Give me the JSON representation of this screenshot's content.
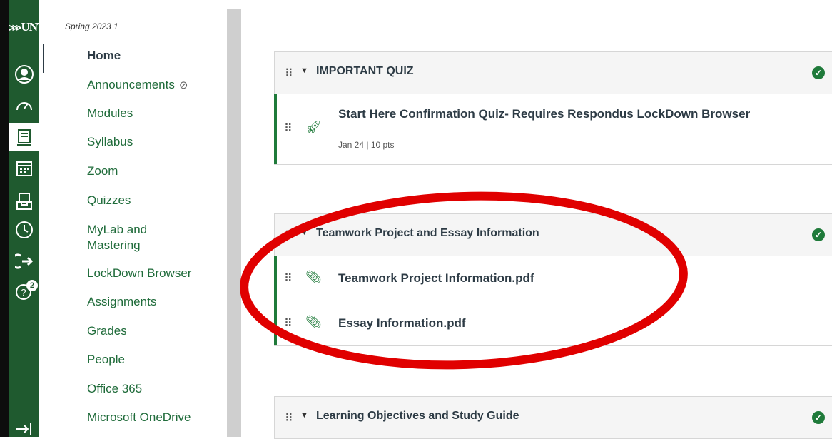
{
  "global_nav": {
    "logo": "UNT",
    "help_badge": "2"
  },
  "course_nav": {
    "term": "Spring 2023 1",
    "items": [
      {
        "label": "Home"
      },
      {
        "label": "Announcements"
      },
      {
        "label": "Modules"
      },
      {
        "label": "Syllabus"
      },
      {
        "label": "Zoom"
      },
      {
        "label": "Quizzes"
      },
      {
        "label": "MyLab and Mastering"
      },
      {
        "label": "LockDown Browser"
      },
      {
        "label": "Assignments"
      },
      {
        "label": "Grades"
      },
      {
        "label": "People"
      },
      {
        "label": "Office 365"
      },
      {
        "label": "Microsoft OneDrive"
      }
    ]
  },
  "modules": [
    {
      "title": "IMPORTANT QUIZ",
      "items": [
        {
          "title": "Start Here Confirmation Quiz- Requires Respondus LockDown Browser",
          "meta": "Jan 24  |  10 pts"
        }
      ]
    },
    {
      "title": "Teamwork Project and Essay Information",
      "items": [
        {
          "title": "Teamwork Project Information.pdf"
        },
        {
          "title": "Essay Information.pdf"
        }
      ]
    },
    {
      "title": "Learning Objectives and Study Guide",
      "items": []
    }
  ],
  "colors": {
    "nav_green": "#1f5a2f",
    "link_green": "#1f6b3a",
    "status_green": "#1f7a3a",
    "annotation_red": "#e00000"
  }
}
